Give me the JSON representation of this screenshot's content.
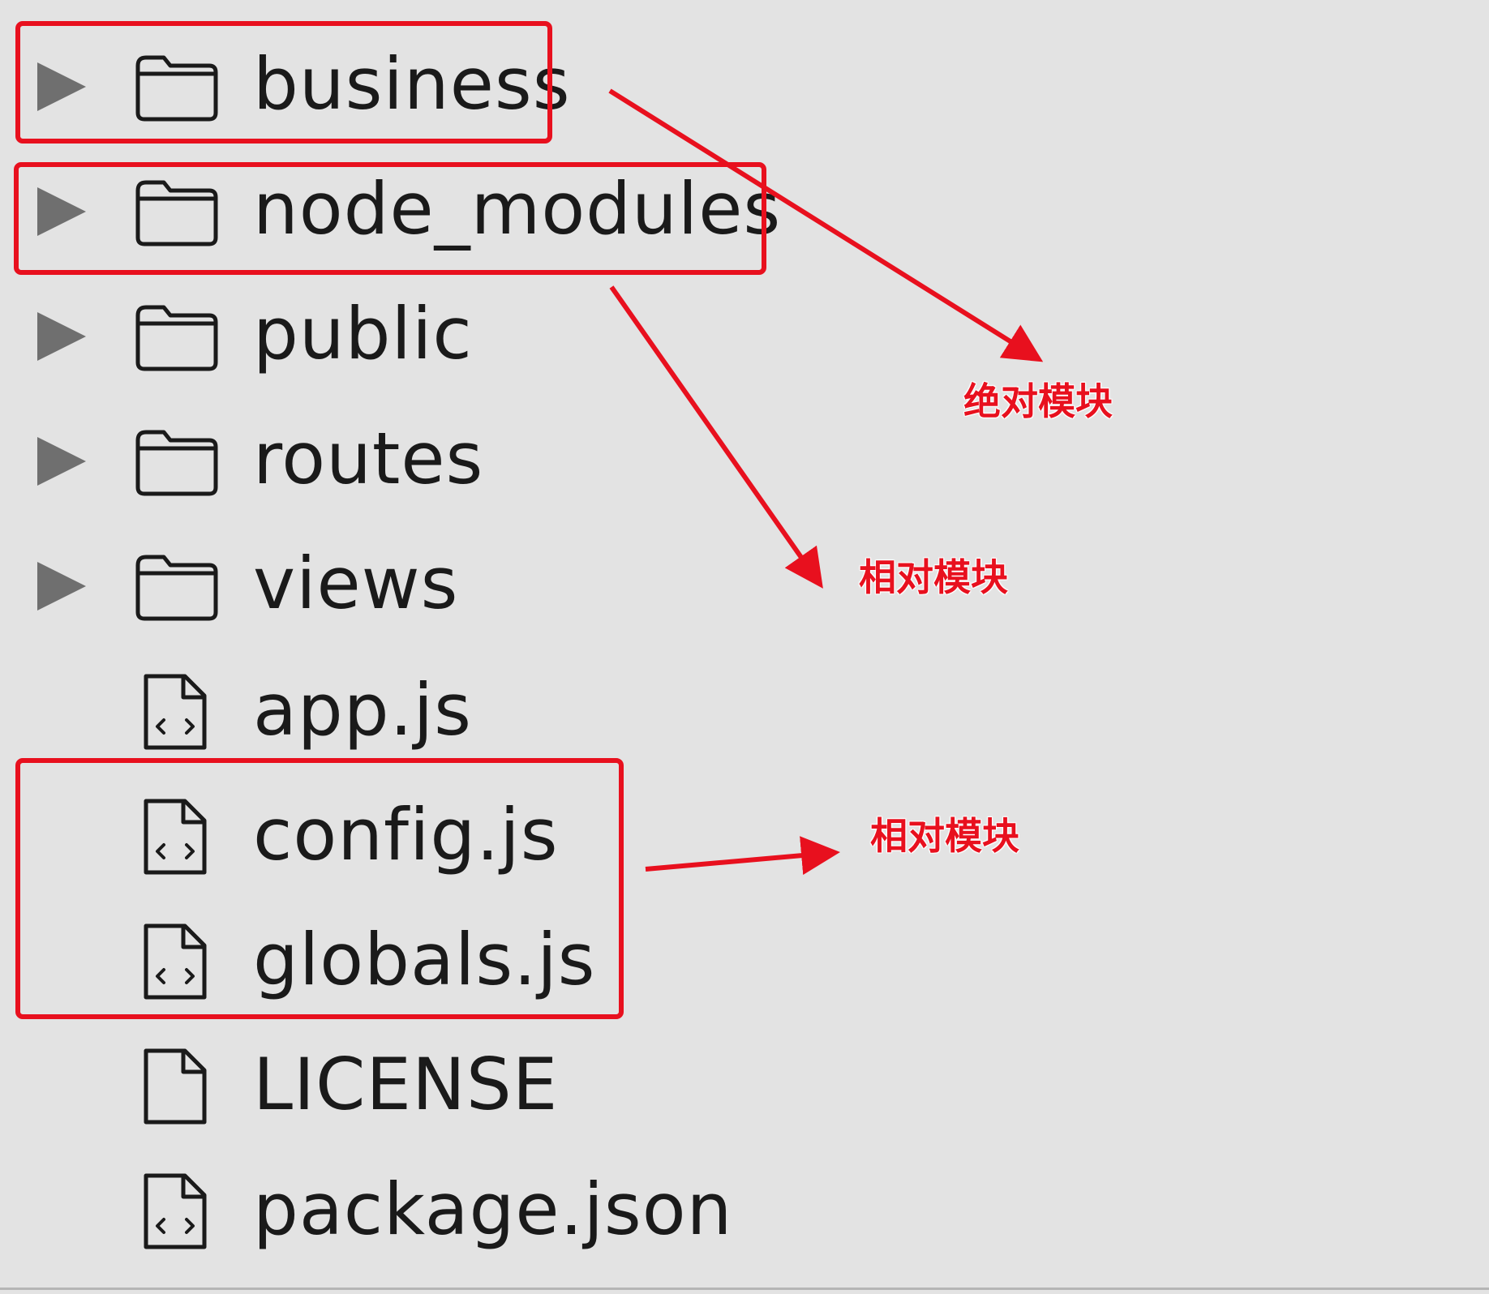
{
  "file_tree": {
    "items": [
      {
        "name": "business",
        "type": "folder",
        "icon": "folder-icon"
      },
      {
        "name": "node_modules",
        "type": "folder",
        "icon": "folder-icon"
      },
      {
        "name": "public",
        "type": "folder",
        "icon": "folder-icon"
      },
      {
        "name": "routes",
        "type": "folder",
        "icon": "folder-icon"
      },
      {
        "name": "views",
        "type": "folder",
        "icon": "folder-icon"
      },
      {
        "name": "app.js",
        "type": "file",
        "icon": "code-file-icon"
      },
      {
        "name": "config.js",
        "type": "file",
        "icon": "code-file-icon"
      },
      {
        "name": "globals.js",
        "type": "file",
        "icon": "code-file-icon"
      },
      {
        "name": "LICENSE",
        "type": "file",
        "icon": "file-icon"
      },
      {
        "name": "package.json",
        "type": "file",
        "icon": "code-file-icon"
      }
    ]
  },
  "annotations": {
    "absolute_module": "绝对模块",
    "relative_module_1": "相对模块",
    "relative_module_2": "相对模块"
  },
  "colors": {
    "background": "#e3e3e3",
    "annotation_red": "#e8101e",
    "disclosure_gray": "#6f6f6f",
    "icon_stroke": "#1a1a1a"
  }
}
